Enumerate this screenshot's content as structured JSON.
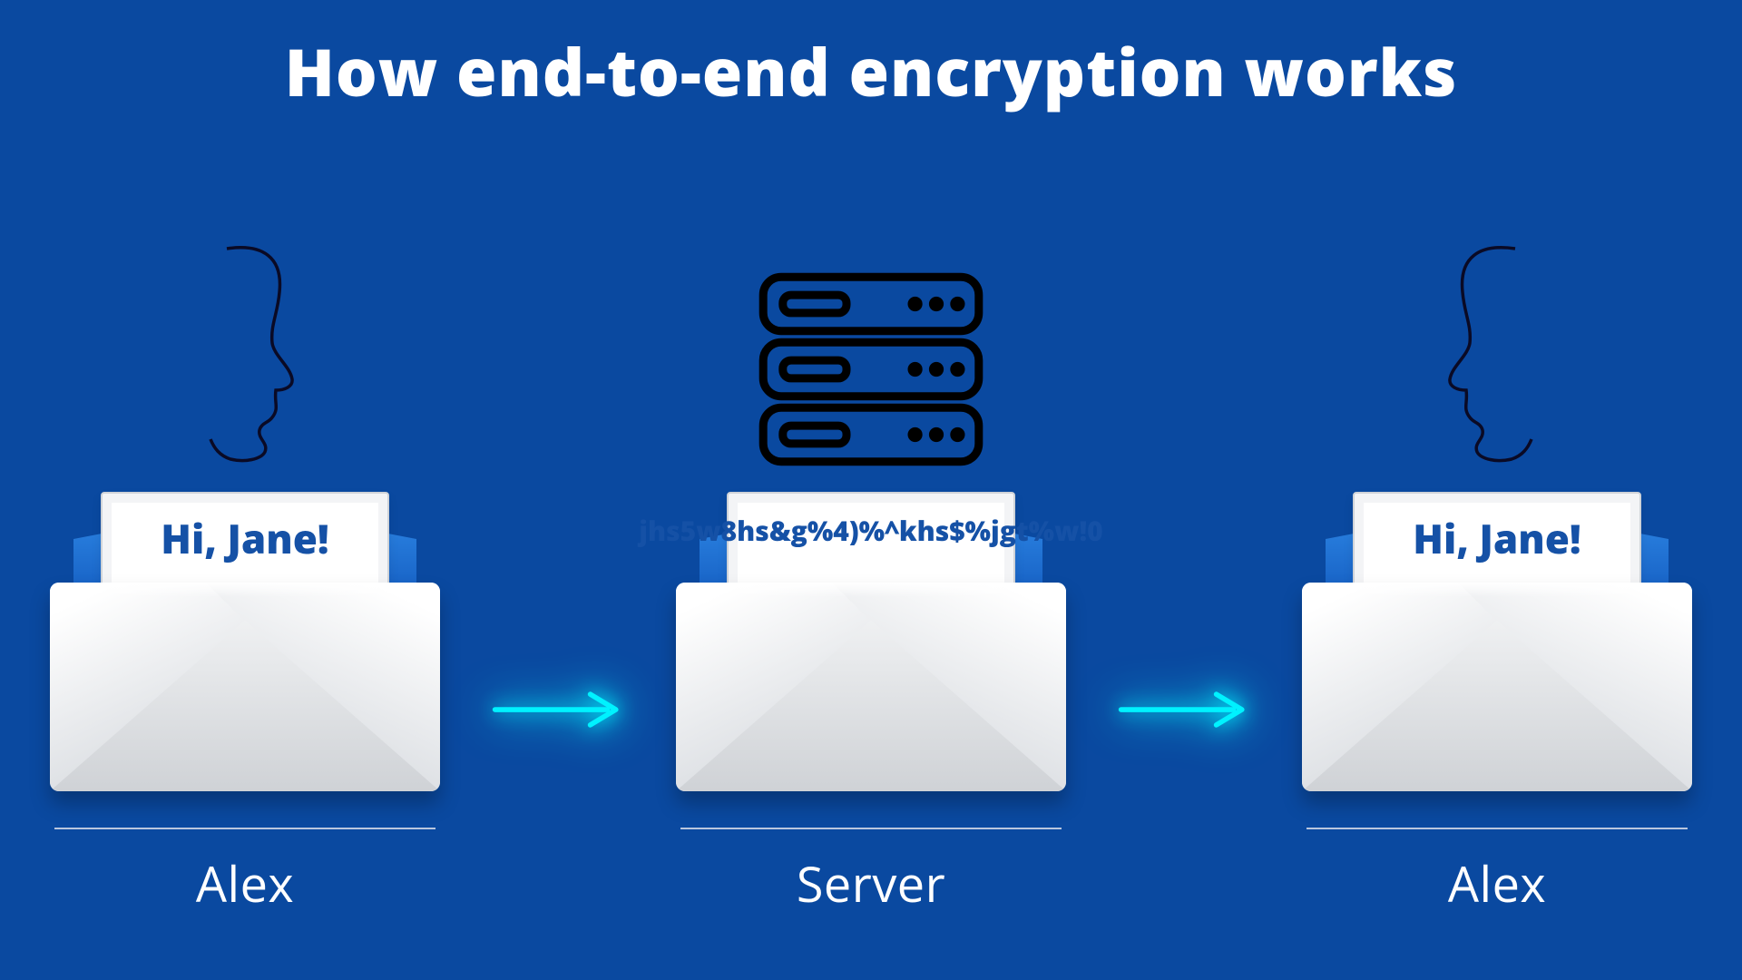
{
  "title": "How end-to-end encryption works",
  "sender": {
    "label": "Alex",
    "message": "Hi, Jane!"
  },
  "server": {
    "label": "Server",
    "ciphertext": "jhs5w8hs&g%4)%^khs$%jgt%w!0"
  },
  "receiver": {
    "label": "Alex",
    "message": "Hi, Jane!"
  }
}
